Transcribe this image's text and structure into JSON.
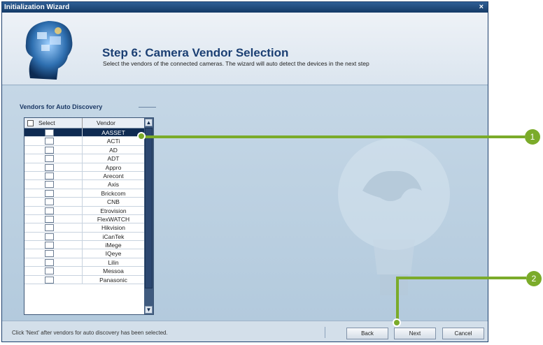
{
  "window": {
    "title": "Initialization Wizard",
    "close_glyph": "×"
  },
  "header": {
    "title": "Step 6: Camera Vendor Selection",
    "description": "Select the vendors of the connected cameras. The wizard will auto detect the devices in the next step",
    "image_icon": "head-globe-icon"
  },
  "vendors_group": {
    "label": "Vendors for Auto Discovery",
    "columns": {
      "select": "Select",
      "vendor": "Vendor"
    },
    "rows": [
      {
        "vendor": "AASSET",
        "selected": true
      },
      {
        "vendor": "ACTi"
      },
      {
        "vendor": "AD"
      },
      {
        "vendor": "ADT"
      },
      {
        "vendor": "Appro"
      },
      {
        "vendor": "Arecont"
      },
      {
        "vendor": "Axis"
      },
      {
        "vendor": "Brickcom"
      },
      {
        "vendor": "CNB"
      },
      {
        "vendor": "Etrovision"
      },
      {
        "vendor": "FlexWATCH"
      },
      {
        "vendor": "Hikvision"
      },
      {
        "vendor": "iCanTek"
      },
      {
        "vendor": "iMege"
      },
      {
        "vendor": "IQeye"
      },
      {
        "vendor": "Lilin"
      },
      {
        "vendor": "Messoa"
      },
      {
        "vendor": "Panasonic"
      }
    ]
  },
  "footer": {
    "status": "Click 'Next' after vendors for auto discovery has been selected.",
    "back": "Back",
    "next": "Next",
    "cancel": "Cancel"
  },
  "callouts": [
    {
      "label": "1"
    },
    {
      "label": "2"
    }
  ],
  "colors": {
    "accent": "#7bab2a",
    "selected_row": "#0f2b52",
    "title_text": "#1b3f73"
  }
}
